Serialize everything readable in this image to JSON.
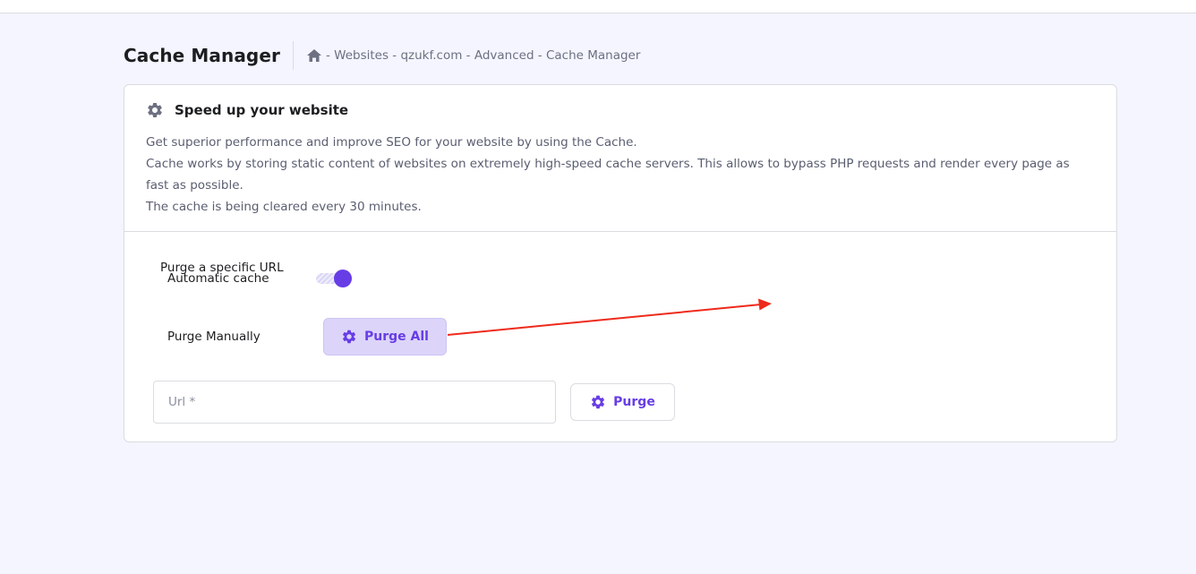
{
  "header": {
    "title": "Cache Manager",
    "breadcrumb": "- Websites - qzukf.com - Advanced - Cache Manager"
  },
  "card": {
    "title": "Speed up your website",
    "description": [
      "Get superior performance and improve SEO for your website by using the Cache.",
      "Cache works by storing static content of websites on extremely high-speed cache servers. This allows to bypass PHP requests and render every page as fast as possible.",
      "The cache is being cleared every 30 minutes."
    ],
    "purge_specific_label": "Purge a specific URL",
    "automatic_cache_label": "Automatic cache",
    "automatic_cache_enabled": true,
    "purge_manually_label": "Purge Manually",
    "purge_all_label": "Purge All",
    "url_placeholder": "Url *",
    "url_value": "",
    "purge_label": "Purge"
  },
  "colors": {
    "accent": "#673de6",
    "accent_light": "#dcd5f9",
    "background": "#f4f5ff",
    "annotation_arrow": "#ee2a1b"
  },
  "icons": {
    "breadcrumb_home": "home-icon",
    "card_title": "gear-icon",
    "purge_all": "gear-icon",
    "purge": "gear-icon"
  }
}
